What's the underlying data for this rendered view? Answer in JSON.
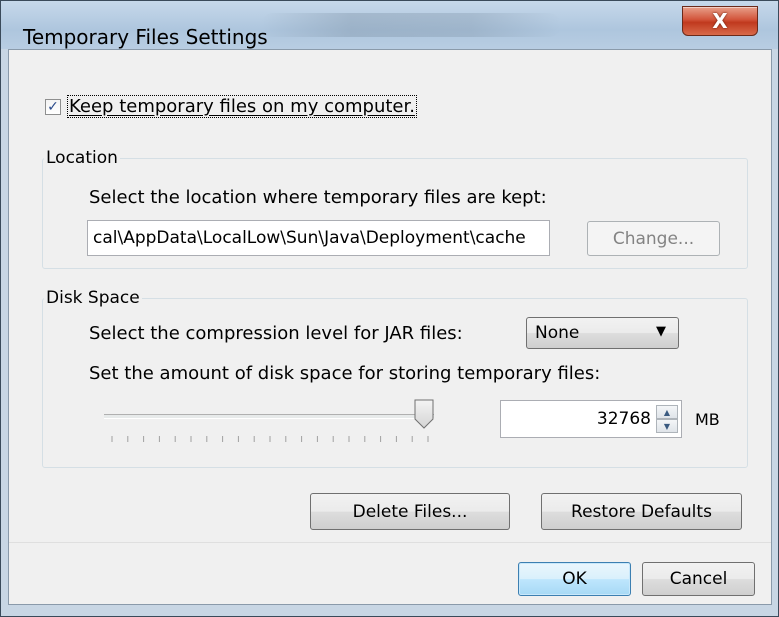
{
  "window": {
    "title": "Temporary Files Settings",
    "close_glyph": "X"
  },
  "keep": {
    "checked": true,
    "check_glyph": "✓",
    "label": "Keep temporary files on my computer."
  },
  "location": {
    "group_label": "Location",
    "description": "Select the location where temporary files are kept:",
    "path_value": "cal\\AppData\\LocalLow\\Sun\\Java\\Deployment\\cache",
    "change_label": "Change..."
  },
  "disk_space": {
    "group_label": "Disk Space",
    "compression_label": "Select the compression level for JAR files:",
    "compression_value": "None",
    "amount_label": "Set the amount of disk space for storing temporary files:",
    "slider_fraction": 0.97,
    "amount_value": "32768",
    "unit": "MB"
  },
  "actions": {
    "delete_label": "Delete Files...",
    "restore_label": "Restore Defaults"
  },
  "footer": {
    "ok_label": "OK",
    "cancel_label": "Cancel"
  },
  "colors": {
    "title_bar": "#b8cde2",
    "close_button": "#c0391e",
    "default_button_border": "#3c7fb1",
    "dialog_background": "#f0f0f0"
  }
}
